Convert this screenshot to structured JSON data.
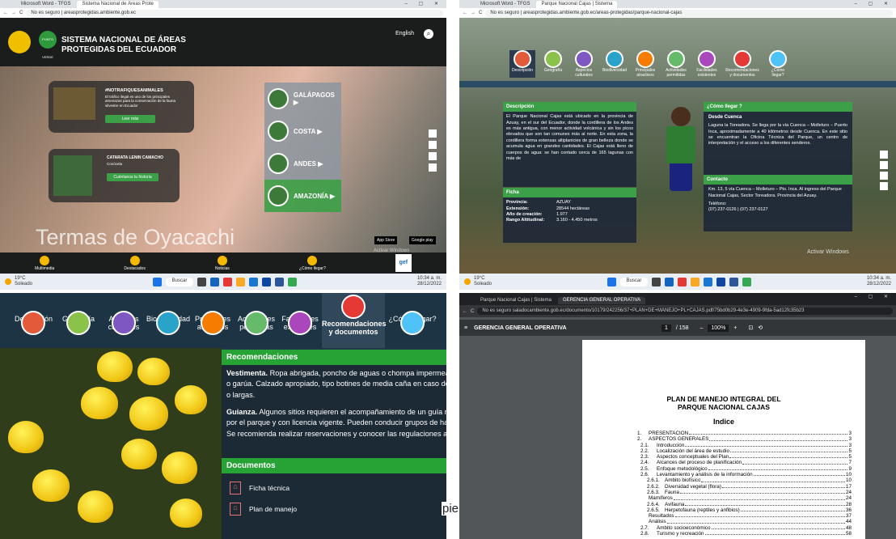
{
  "q1": {
    "tabs": [
      "Microsoft Word - TFGS",
      "Sistema Nacional de Áreas Prote"
    ],
    "address": "No es seguro | areasprotegidas.ambiente.gob.ec",
    "site_title_1": "SISTEMA NACIONAL DE ÁREAS",
    "site_title_2": "PROTEGIDAS DEL ECUADOR",
    "logo_text": "PUNTO VERDE",
    "language": "English",
    "card1_title": "#NOTRAFIQUESANIMALES",
    "card1_text": "El tráfico ilegal es uno de los principales amenazas para la conservación de la fauna silvestre en Ecuador",
    "card1_btn": "Leer más",
    "card2_title": "CATARATA LENIN CAMACHO",
    "card2_text": "Conócela",
    "card2_btn": "Cuéntanos tu historia",
    "regions": [
      "GALÁPAGOS ▶",
      "COSTA ▶",
      "ANDES ▶",
      "AMAZONÍA ▶"
    ],
    "watermark": "Termas de Oyacachi",
    "bottom": [
      "Multimedia",
      "Destacados",
      "Noticias",
      "¿Cómo llegar?"
    ],
    "store1": "App Store",
    "store2": "Google play",
    "activate": "Activar Windows",
    "gef": "gef",
    "temp": "19°C",
    "weather": "Soleado",
    "search": "Buscar",
    "time": "10:34 a. m.",
    "date": "28/12/2022"
  },
  "q2": {
    "tabs": [
      "Microsoft Word - TFGS",
      "Parque Nacional Cajas | Sistema"
    ],
    "address": "No es seguro | areasprotegidas.ambiente.gob.ec/areas-protegidas/parque-nacional-cajas",
    "nav": [
      "Descripción",
      "Geografía",
      "Aspectos culturales",
      "Biodiversidad",
      "Principales atractivos",
      "Actividades permitidas",
      "Facilidades existentes",
      "Recomendaciones y documentos",
      "¿Cómo llegar?"
    ],
    "desc_head": "Descripción",
    "desc_text": "El Parque Nacional Cajas está ubicado en la provincia de Azuay, en el sur del Ecuador, donde la cordillera de los Andes es más antigua, con menor actividad volcánica y sin los picos elevados que son tan comunes más al norte. En esta zona, la cordillera forma extensas altiplanicies de gran belleza donde se acumula agua en grandes cantidades. El Cajas está lleno de cuerpos de agua: se han contado cerca de 165 lagunas con más de",
    "ficha_head": "Ficha",
    "ficha": [
      {
        "k": "Provincia:",
        "v": "AZUAY"
      },
      {
        "k": "Extensión:",
        "v": "28544 hectáreas"
      },
      {
        "k": "Año de creación:",
        "v": "1.977"
      },
      {
        "k": "Rango Altitudinal:",
        "v": "3.160 - 4.450 metros"
      }
    ],
    "llegar_head": "¿Cómo llegar ?",
    "llegar_sub": "Desde Cuenca",
    "llegar_text": "Laguna la Toreadora. Se llega por la vía Cuenca – Molleturo – Puerto Inca, aproximadamente a 40 kilómetros desde Cuenca. En este sitio se encuentran la Oficina Técnica del Parque, un centro de interpretación y el acceso a los diferentes senderos.",
    "contacto_head": "Contacto",
    "contacto_text": "Km. 13, 5 vía Cuenca – Molleturo – Pto. Inca. Al ingreso del Parque Nacional Cajas, Sector Toreadora. Provincia del Azuay.",
    "telefono": "Teléfono:",
    "telefono_num": "(07) 237-0126 | (07) 237-0127",
    "activate": "Activar Windows",
    "temp": "19°C",
    "weather": "Soleado",
    "search": "Buscar",
    "time": "10:34 a. m.",
    "date": "28/12/2022"
  },
  "q3": {
    "nav": [
      "Descripción",
      "Geografía",
      "Aspectos\nculturales",
      "Biodiversidad",
      "Principales\natractivos",
      "Actividades\npermitidas",
      "Facilidades\nexistentes",
      "Recomendaciones\ny documentos",
      "¿Cómo llegar?"
    ],
    "rec_head": "Recomendaciones",
    "rec_lines": [
      {
        "b": "Vestimenta.",
        "t": " Ropa abrigada, poncho de aguas o chompa impermeable e"
      },
      {
        "b": "",
        "t": "o garúa. Calzado apropiado, tipo botines de media caña en caso de camir"
      },
      {
        "b": "",
        "t": "o largas."
      },
      {
        "b": "",
        "t": ""
      },
      {
        "b": "Guianza.",
        "t": " Algunos sitios requieren el acompañamiento de un guía natura"
      },
      {
        "b": "",
        "t": "por el parque y con licencia vigente. Pueden conducir grupos de hasta 15 p"
      },
      {
        "b": "",
        "t": "Se recomienda realizar reservaciones y conocer las regulaciones antes de"
      }
    ],
    "doc_head": "Documentos",
    "docs": [
      "Ficha técnica",
      "Plan de manejo"
    ]
  },
  "q4": {
    "tabs": [
      "Parque Nacional Cajas | Sistema",
      "GERENCIA GENERAL OPERATIVA"
    ],
    "address": "No es seguro  saladocambiente.gob.ec/documento/10179/242256/37+PLAN+DE+MANEJO+PL+CAJAS.pdf/75bd0b29-4e3e-4909-9fda-5ad12fc35b23",
    "doc_title": "GERENCIA GENERAL OPERATIVA",
    "page": "1",
    "pages": "/ 158",
    "zoom": "100%",
    "title1": "PLAN DE MANEJO INTEGRAL DEL",
    "title2": "PARQUE NACIONAL CAJAS",
    "index": "Indice",
    "toc": [
      {
        "n": "1.",
        "t": "PRESENTACIÓN",
        "p": "3"
      },
      {
        "n": "2.",
        "t": "ASPECTOS GENERALES",
        "p": "3"
      },
      {
        "n": "2.1.",
        "t": "Introducción",
        "p": "3"
      },
      {
        "n": "2.2.",
        "t": "Localización del área de estudio",
        "p": "5"
      },
      {
        "n": "2.3.",
        "t": "Aspectos conceptuales del Plan",
        "p": "5"
      },
      {
        "n": "2.4.",
        "t": "Alcances del proceso de planificación",
        "p": "7"
      },
      {
        "n": "2.5.",
        "t": "Enfoque metodológico",
        "p": "9"
      },
      {
        "n": "2.6.",
        "t": "Levantamiento y análisis de la información",
        "p": "10"
      },
      {
        "n": "2.6.1.",
        "t": "Ámbito biofísico",
        "p": "10"
      },
      {
        "n": "2.6.2.",
        "t": "Diversidad vegetal (flora)",
        "p": "17"
      },
      {
        "n": "2.6.3.",
        "t": "Fauna",
        "p": "24"
      },
      {
        "n": "",
        "t": "Mamíferos",
        "p": "24"
      },
      {
        "n": "2.6.4.",
        "t": "Avifauna",
        "p": "28"
      },
      {
        "n": "2.6.5.",
        "t": "Herpetofauna (reptiles y anfibios)",
        "p": "36"
      },
      {
        "n": "",
        "t": "Resultados",
        "p": "37"
      },
      {
        "n": "",
        "t": "Análisis",
        "p": "44"
      },
      {
        "n": "2.7.",
        "t": "Ámbito socioeconómico",
        "p": "48"
      },
      {
        "n": "2.8.",
        "t": "Turismo y recreación",
        "p": "58"
      }
    ]
  },
  "overlay_text": "pie"
}
